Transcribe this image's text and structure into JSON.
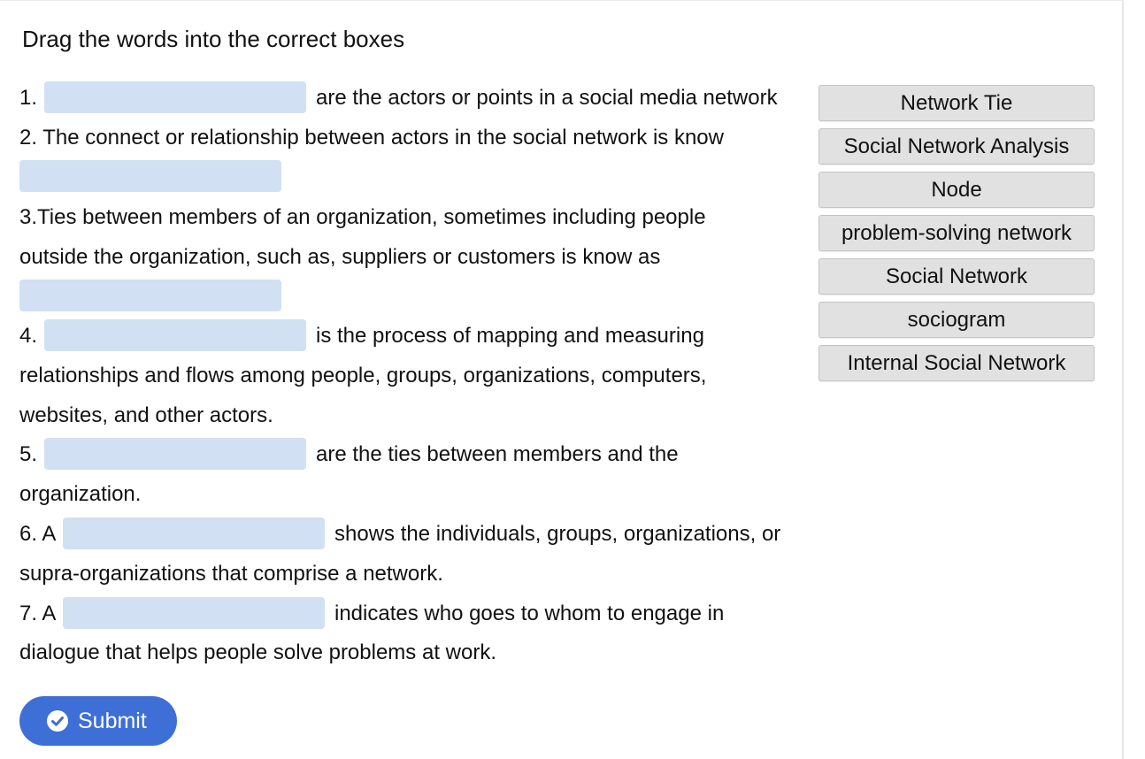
{
  "instructions": "Drag the words into the correct boxes",
  "questions": {
    "q1": {
      "prefix": "1.",
      "suffix": "are the actors or points in a social media network"
    },
    "q2": {
      "line1": "2. The connect or relationship between actors in the social network is know"
    },
    "q3": {
      "line1": "3.Ties between members of an organization, sometimes including people",
      "line2": "outside the organization, such as, suppliers or customers is know as"
    },
    "q4": {
      "prefix": "4.",
      "suffix": "is the process of mapping and measuring",
      "line2": "relationships and flows among people, groups, organizations, computers,",
      "line3": "websites, and other actors."
    },
    "q5": {
      "prefix": "5.",
      "suffix": "are the ties between members and the",
      "line2": "organization."
    },
    "q6": {
      "prefix": "6. A",
      "suffix": "shows the individuals, groups, organizations, or",
      "line2": "supra-organizations that comprise a network."
    },
    "q7": {
      "prefix": "7. A",
      "suffix": "indicates who goes to whom to engage in",
      "line2": "dialogue that helps people solve problems at work."
    }
  },
  "word_bank": [
    "Network Tie",
    "Social Network Analysis",
    "Node",
    "problem-solving network",
    "Social Network",
    "sociogram",
    "Internal Social Network"
  ],
  "submit": {
    "label": "Submit",
    "icon": "check-circle-icon"
  },
  "colors": {
    "drop_slot": "#d1e0f2",
    "word_chip": "#e1e1e1",
    "submit_button": "#3d6fd6"
  }
}
